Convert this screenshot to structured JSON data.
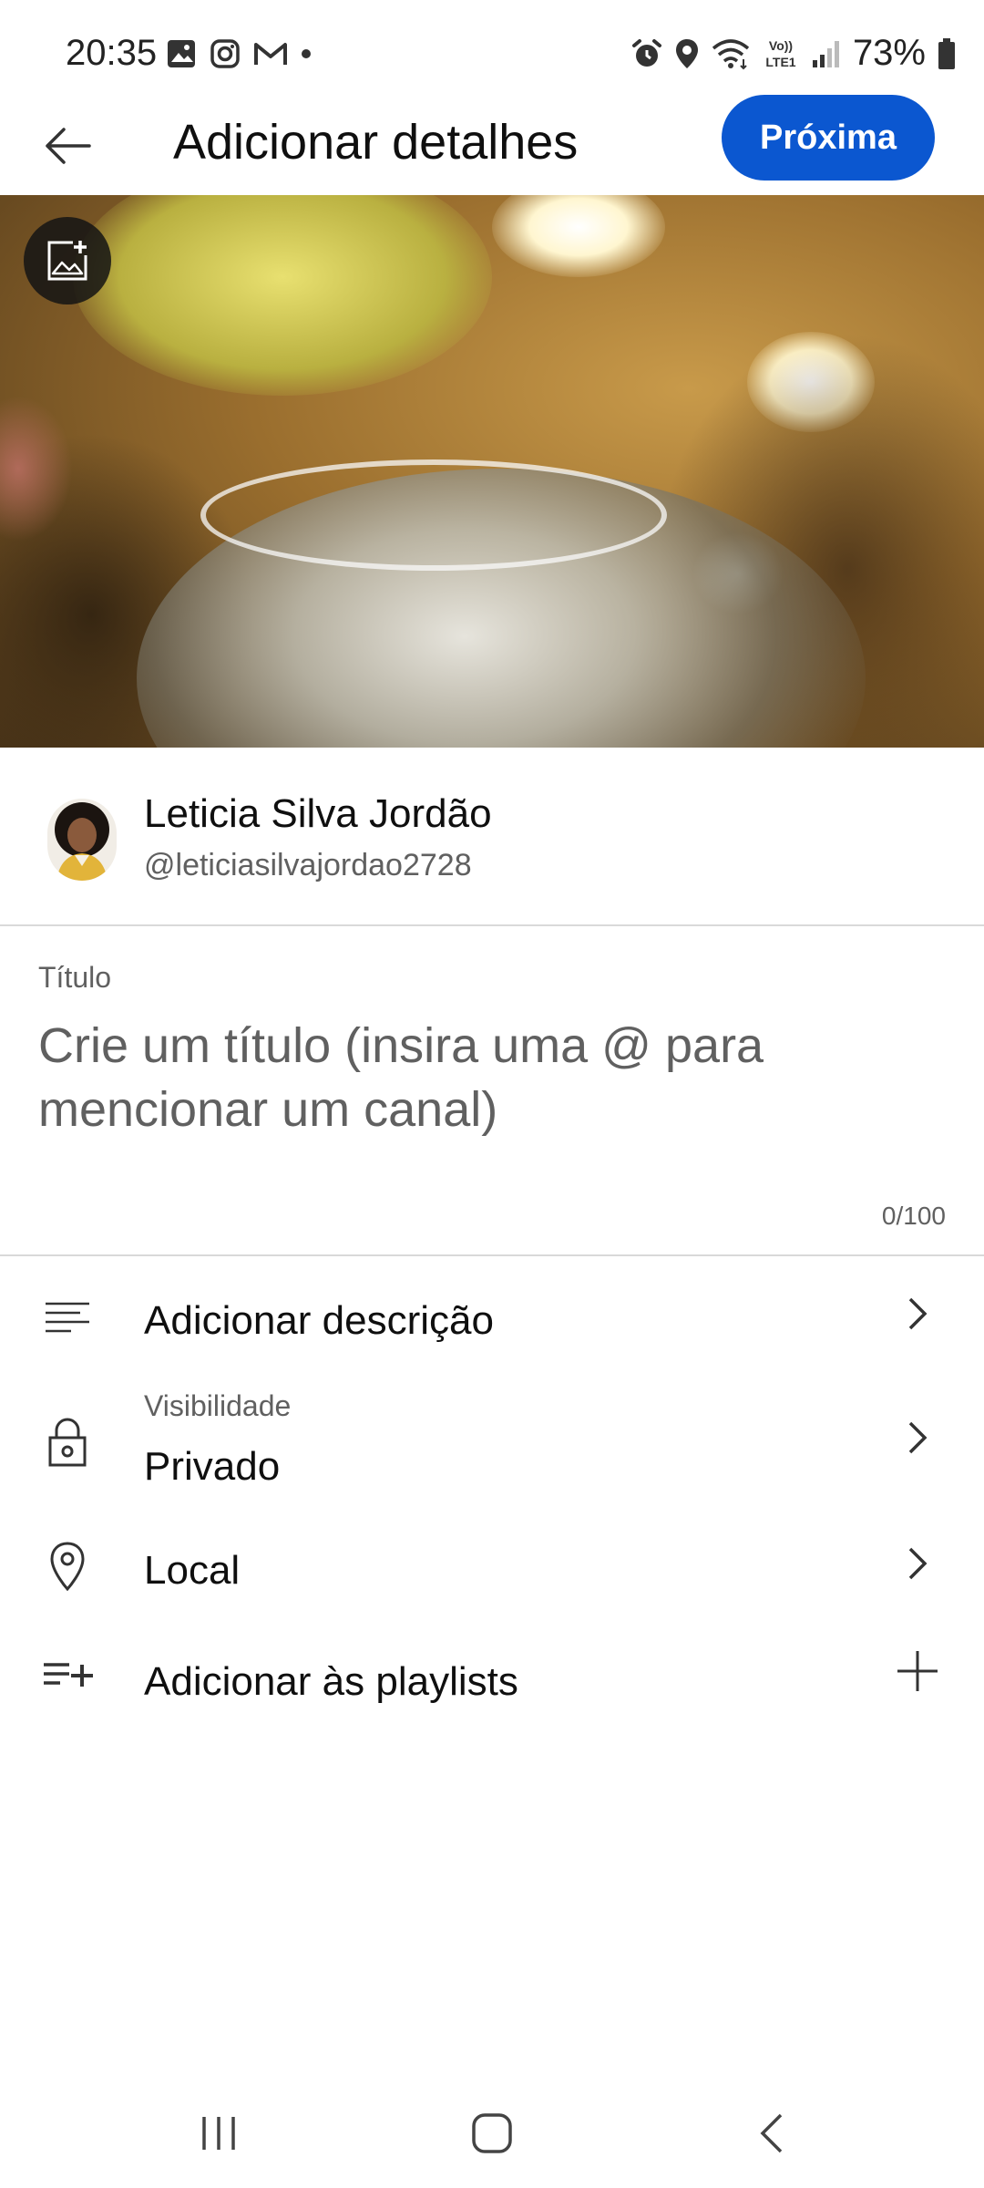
{
  "status_bar": {
    "time": "20:35",
    "battery_percent": "73%",
    "network_label": "Vo)) LTE1",
    "left_icons": [
      "gallery-icon",
      "instagram-icon",
      "gmail-icon",
      "dot-icon"
    ],
    "right_icons": [
      "alarm-icon",
      "location-icon",
      "wifi-icon",
      "volte-icon",
      "signal-icon",
      "battery-icon"
    ]
  },
  "header": {
    "title": "Adicionar detalhes",
    "next_label": "Próxima"
  },
  "thumbnail": {
    "edit_icon": "add-image-icon"
  },
  "channel": {
    "name": "Leticia Silva Jordão",
    "handle": "@leticiasilvajordao2728"
  },
  "title_field": {
    "label": "Título",
    "placeholder": "Crie um título (insira uma @ para mencionar um canal)",
    "value": "",
    "counter": "0/100"
  },
  "menu": {
    "description": {
      "label": "Adicionar descrição",
      "icon": "description-icon"
    },
    "visibility": {
      "sublabel": "Visibilidade",
      "label": "Privado",
      "icon": "lock-icon"
    },
    "location": {
      "label": "Local",
      "icon": "location-pin-icon"
    },
    "playlists": {
      "label": "Adicionar às playlists",
      "icon": "playlist-add-icon"
    }
  },
  "colors": {
    "accent": "#0b57d0",
    "text_primary": "#0f0f0f",
    "text_secondary": "#606060",
    "divider": "#d9d9d9"
  }
}
